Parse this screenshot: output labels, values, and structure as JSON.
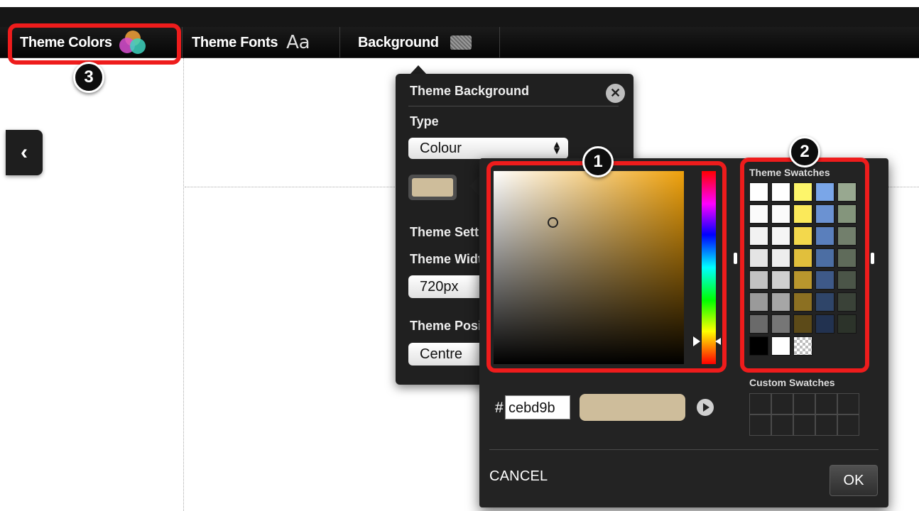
{
  "menubar": {
    "items": [
      {
        "label": "Theme Colors",
        "icon": "color-circles-icon"
      },
      {
        "label": "Theme Fonts",
        "icon": "font-icon",
        "icon_text": "Aa"
      },
      {
        "label": "Background",
        "icon": "background-pattern-icon"
      }
    ]
  },
  "callouts": [
    "1",
    "2",
    "3"
  ],
  "sidebar": {
    "toggle_glyph": "‹"
  },
  "background_panel": {
    "title": "Theme Background",
    "type_label": "Type",
    "type_value": "Colour",
    "color_value": "#cebd9b",
    "settings_label": "Theme Settings",
    "width_label": "Theme Width",
    "width_value": "720px",
    "position_label": "Theme Position",
    "position_value": "Centre",
    "close_glyph": "✕"
  },
  "color_picker": {
    "base_hue": "#efa10b",
    "hex_value": "cebd9b",
    "preview_color": "#cebd9b",
    "theme_swatches_label": "Theme Swatches",
    "custom_swatches_label": "Custom Swatches",
    "theme_swatches": [
      "#ffffff",
      "#ffffff",
      "#fdf56a",
      "#7aa6e8",
      "#98a890",
      "#fbfbfb",
      "#fafafa",
      "#fbe95a",
      "#6b92d2",
      "#84957c",
      "#f2f2f2",
      "#f5f5f5",
      "#f3d84c",
      "#5a7fbc",
      "#727f6c",
      "#e4e4e4",
      "#ededed",
      "#e1bf3c",
      "#4c6ea3",
      "#5f6b5a",
      "#c2c2c2",
      "#cfcfcf",
      "#b9962d",
      "#3e5988",
      "#4b5548",
      "#9a9a9a",
      "#a6a6a6",
      "#8c7022",
      "#2f4569",
      "#3a4238",
      "#6a6a6a",
      "#767676",
      "#5c4a18",
      "#223250",
      "#2c332a",
      "#000000",
      "#ffffff",
      "transparent"
    ],
    "custom_swatch_count": 10,
    "cancel_label": "CANCEL",
    "ok_label": "OK"
  }
}
